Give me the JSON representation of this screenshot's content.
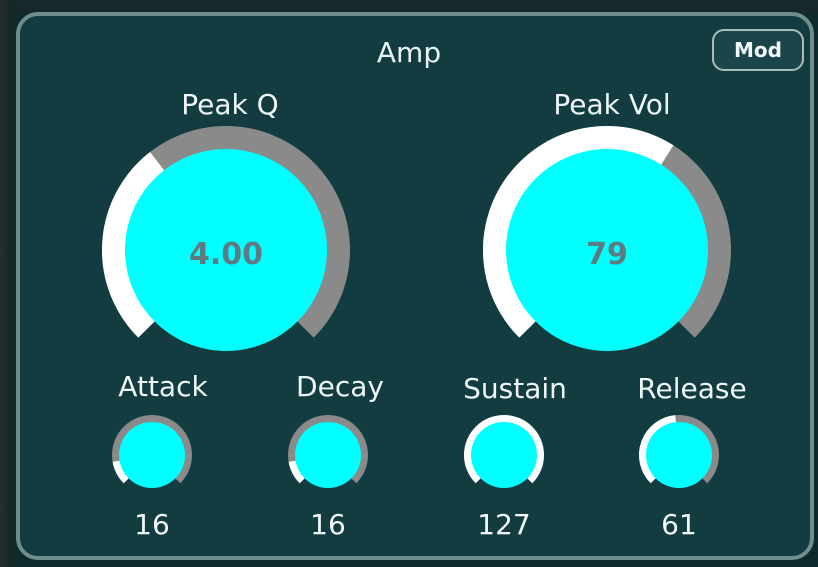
{
  "panel": {
    "title": "Amp",
    "mod_label": "Mod"
  },
  "colors": {
    "knob_fill": "#00ffff",
    "arc_active": "#ffffff",
    "arc_inactive": "#8a8a8a",
    "panel_bg": "#123c3f"
  },
  "knobs": {
    "peak_q": {
      "label": "Peak Q",
      "value": "4.00",
      "level": 0.36
    },
    "peak_vol": {
      "label": "Peak Vol",
      "value": "79",
      "level": 0.62
    },
    "attack": {
      "label": "Attack",
      "value": "16",
      "level": 0.13
    },
    "decay": {
      "label": "Decay",
      "value": "16",
      "level": 0.13
    },
    "sustain": {
      "label": "Sustain",
      "value": "127",
      "level": 1.0
    },
    "release": {
      "label": "Release",
      "value": "61",
      "level": 0.48
    }
  }
}
